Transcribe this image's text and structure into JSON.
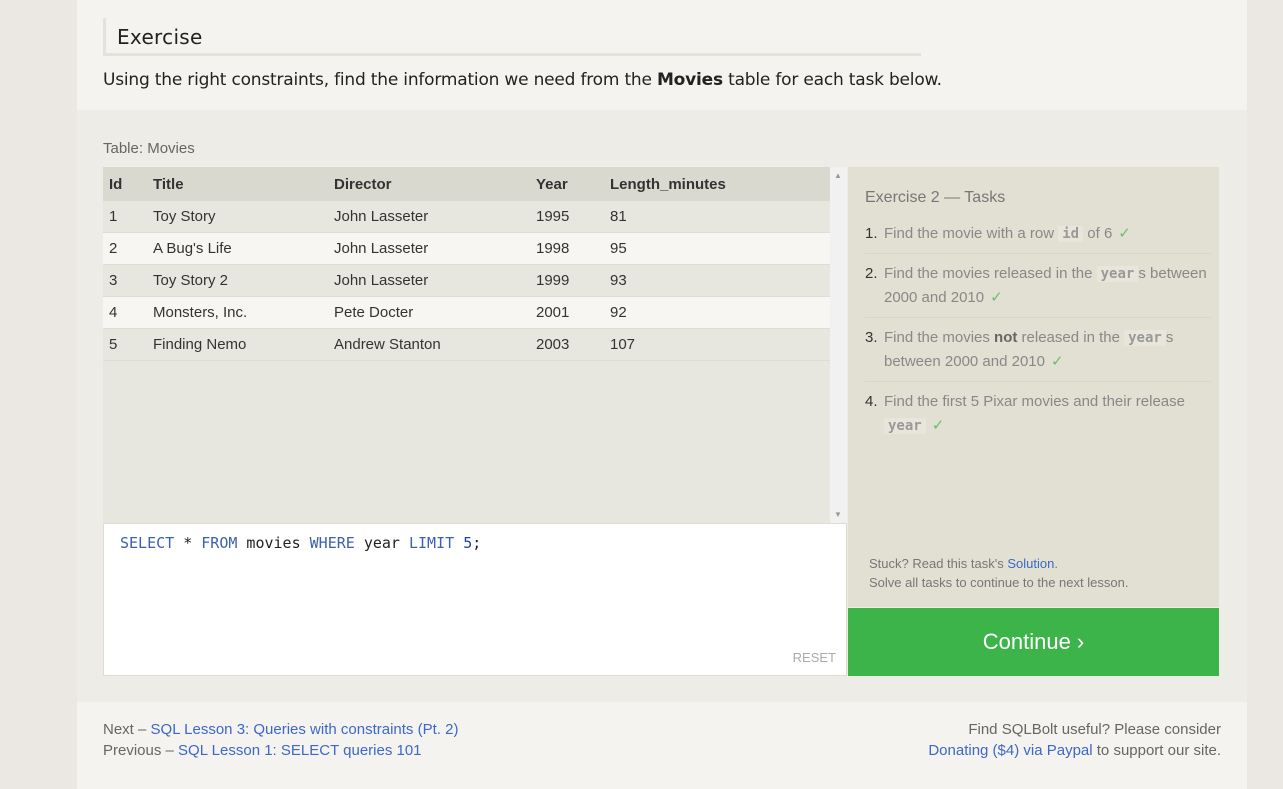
{
  "exercise": {
    "heading": "Exercise",
    "intro_before": "Using the right constraints, find the information we need from the ",
    "intro_bold": "Movies",
    "intro_after": " table for each task below."
  },
  "table": {
    "caption": "Table: Movies",
    "columns": [
      "Id",
      "Title",
      "Director",
      "Year",
      "Length_minutes"
    ],
    "rows": [
      [
        "1",
        "Toy Story",
        "John Lasseter",
        "1995",
        "81"
      ],
      [
        "2",
        "A Bug's Life",
        "John Lasseter",
        "1998",
        "95"
      ],
      [
        "3",
        "Toy Story 2",
        "John Lasseter",
        "1999",
        "93"
      ],
      [
        "4",
        "Monsters, Inc.",
        "Pete Docter",
        "2001",
        "92"
      ],
      [
        "5",
        "Finding Nemo",
        "Andrew Stanton",
        "2003",
        "107"
      ]
    ]
  },
  "editor": {
    "kw_select": "SELECT",
    "star": " * ",
    "kw_from": "FROM",
    "table_name": " movies ",
    "kw_where": "WHERE",
    "column": " year ",
    "kw_limit": "LIMIT",
    "space": " ",
    "limit_value": "5",
    "semicolon": ";",
    "reset_label": "RESET"
  },
  "tasks": {
    "title": "Exercise 2 — Tasks",
    "items": [
      {
        "num": "1.",
        "pre": "Find the movie with a row ",
        "code": "id",
        "post": " of 6",
        "check": "✓"
      },
      {
        "num": "2.",
        "pre": "Find the movies released in the ",
        "code": "year",
        "post": "s between 2000 and 2010",
        "check": "✓"
      },
      {
        "num": "3.",
        "pre": "Find the movies ",
        "bold": "not",
        "mid": " released in the ",
        "code": "year",
        "post": "s between 2000 and 2010",
        "check": "✓"
      },
      {
        "num": "4.",
        "pre": "Find the first 5 Pixar movies and their release ",
        "code": "year",
        "post": "",
        "check": "✓"
      }
    ],
    "stuck_pre": "Stuck? Read this task's ",
    "stuck_link": "Solution",
    "stuck_post": ".",
    "solve_all": "Solve all tasks to continue to the next lesson.",
    "continue_label": "Continue ›"
  },
  "footer": {
    "next_prefix": "Next – ",
    "next_link": "SQL Lesson 3: Queries with constraints (Pt. 2)",
    "prev_prefix": "Previous – ",
    "prev_link": "SQL Lesson 1: SELECT queries 101",
    "useful": "Find SQLBolt useful? Please consider",
    "donate_link": "Donating ($4) via Paypal",
    "donate_post": " to support our site."
  },
  "colors": {
    "continue": "#3cb44a",
    "link": "#3c68c8",
    "check": "#6bbf6b"
  }
}
